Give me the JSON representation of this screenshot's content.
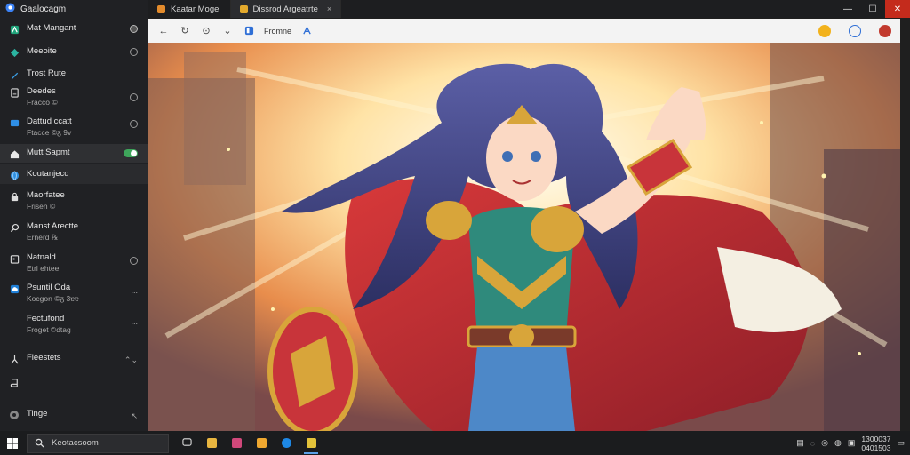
{
  "window": {
    "app_title": "Gaalocagm",
    "tabs": [
      {
        "label": "Kaatar Mogel",
        "favicon_color": "#e38b2c",
        "active": false
      },
      {
        "label": "Dissrod Argeatrte",
        "favicon_color": "#e3a92c",
        "active": true,
        "close": "×"
      }
    ],
    "controls": {
      "minimize": "—",
      "maximize": "☐",
      "close": "✕"
    }
  },
  "sidebar": {
    "items": [
      {
        "label": "Mat Mangant",
        "sub": "",
        "icon": "app-icon",
        "right": "radio"
      },
      {
        "label": "Meeoite",
        "sub": "",
        "icon": "puzzle-icon",
        "right": "radio"
      },
      {
        "label": "Trost Rute",
        "sub": "",
        "icon": "pen-icon",
        "right": ""
      },
      {
        "label": "Deedes",
        "sub": "Fracco ©",
        "icon": "doc-icon",
        "right": "radio"
      },
      {
        "label": "Dattud ccatt",
        "sub": "Ftacce ©ᵹ 9v",
        "icon": "folder-icon",
        "right": "radio"
      },
      {
        "label": "Mutt Sapmt",
        "sub": "",
        "icon": "house-icon",
        "right": "toggle"
      },
      {
        "label": "Koutanjecd",
        "sub": "",
        "icon": "globe-icon",
        "right": ""
      },
      {
        "label": "Maorfatee",
        "sub": "Frisen ©",
        "icon": "lock-icon",
        "right": ""
      },
      {
        "label": "Manst Arectte",
        "sub": "Ernerd ℞",
        "icon": "search-icon",
        "right": ""
      },
      {
        "label": "Natnald",
        "sub": "Etrl ehtee",
        "icon": "calendar-icon",
        "right": "radio"
      },
      {
        "label": "Psuntil Oda",
        "sub": "Kocgon ©ᵹ 3ɐɐ",
        "icon": "cloud-icon",
        "right": "..."
      },
      {
        "label": "Fectufond",
        "sub": "Froget ©dtag",
        "icon": "",
        "right": "..."
      },
      {
        "label": "Fleestets",
        "sub": "",
        "icon": "person-icon",
        "right": "⌃⌄"
      },
      {
        "label": "",
        "sub": "",
        "icon": "book-icon",
        "right": ""
      },
      {
        "label": "Tinge",
        "sub": "",
        "icon": "settings-icon",
        "right": "↖"
      }
    ]
  },
  "toolbar": {
    "address": "Fromne",
    "nav": [
      "←",
      "↻",
      "⊙",
      "⌄"
    ]
  },
  "taskbar": {
    "search_placeholder": "Keotacsoom",
    "clock_time": "1300037",
    "clock_date": "0401503"
  },
  "colors": {
    "accent": "#5aa0e6",
    "toggle_on": "#3ea55b",
    "close_red": "#c42b1c"
  }
}
